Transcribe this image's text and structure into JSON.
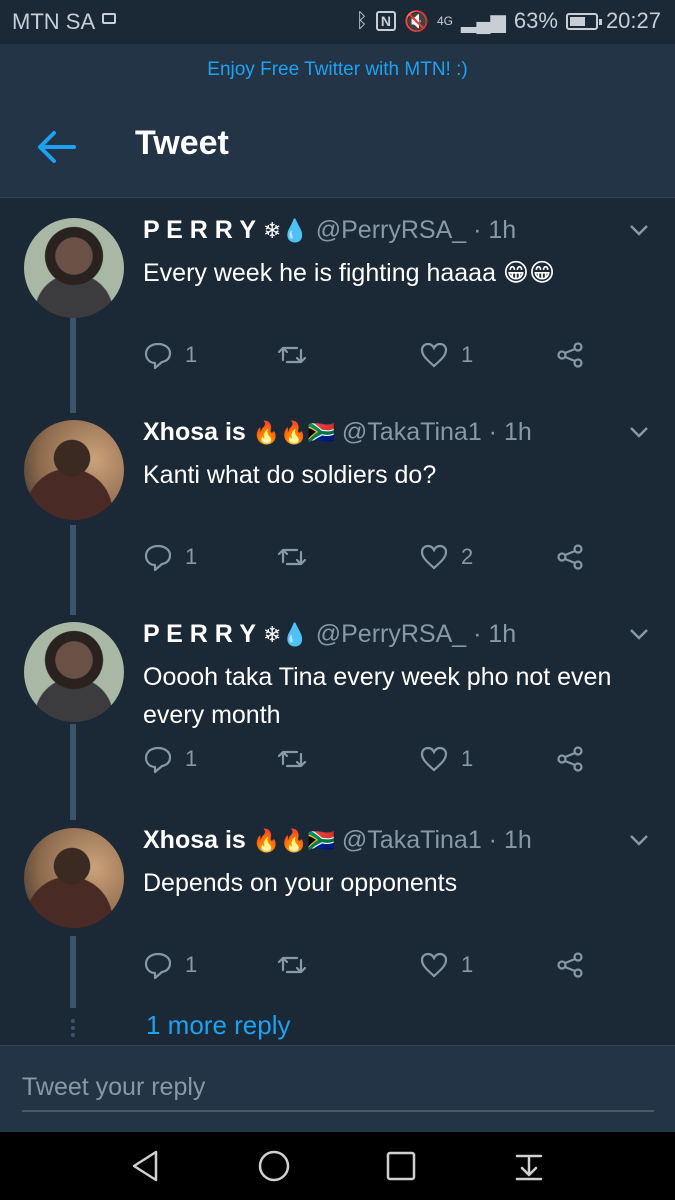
{
  "status_bar": {
    "carrier": "MTN SA",
    "network": "4G",
    "battery": "63%",
    "battery_level": 0.63,
    "time": "20:27"
  },
  "promo": {
    "text": "Enjoy Free Twitter with MTN! :)"
  },
  "header": {
    "title": "Tweet"
  },
  "tweets": [
    {
      "name": "P E R R Y",
      "name_emoji": "❄💧",
      "handle": "@PerryRSA_",
      "time": "· 1h",
      "text": "Every week he is fighting haaaa 😁😁",
      "replies": "1",
      "retweets": "",
      "likes": "1"
    },
    {
      "name": "Xhosa is",
      "name_emoji": "🔥🔥🇿🇦",
      "handle": "@TakaTina1",
      "time": "· 1h",
      "text": "Kanti what do soldiers do?",
      "replies": "1",
      "retweets": "",
      "likes": "2"
    },
    {
      "name": "P E R R Y",
      "name_emoji": "❄💧",
      "handle": "@PerryRSA_",
      "time": "· 1h",
      "text": "Ooooh taka Tina every week pho not even every month",
      "replies": "1",
      "retweets": "",
      "likes": "1"
    },
    {
      "name": "Xhosa is",
      "name_emoji": "🔥🔥🇿🇦",
      "handle": "@TakaTina1",
      "time": "· 1h",
      "text": "Depends on your opponents",
      "replies": "1",
      "retweets": "",
      "likes": "1"
    }
  ],
  "more_replies": "1 more reply",
  "compose": {
    "placeholder": "Tweet your reply"
  },
  "colors": {
    "accent": "#1da1f2",
    "background": "#1b2836",
    "secondary_text": "#8899a6"
  }
}
